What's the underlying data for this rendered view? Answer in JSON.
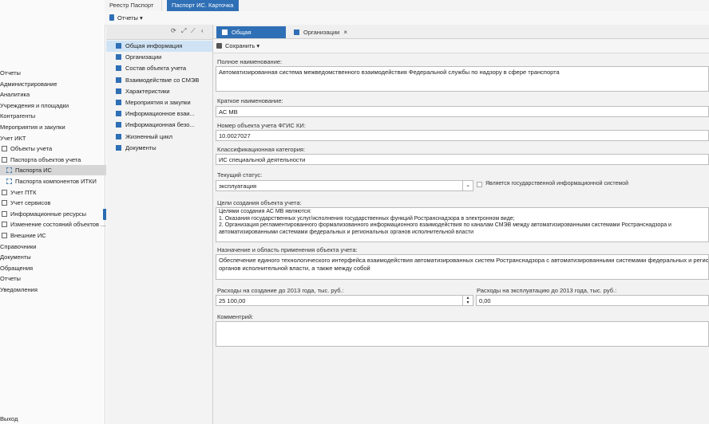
{
  "nav": {
    "items": [
      {
        "label": "Отчеты",
        "indent": 0,
        "icon": "none"
      },
      {
        "label": "Администрирование",
        "indent": 0,
        "icon": "none"
      },
      {
        "label": "Аналитика",
        "indent": 0,
        "icon": "none"
      },
      {
        "label": "Учреждения и площадки",
        "indent": 0,
        "icon": "none"
      },
      {
        "label": "Контрагенты",
        "indent": 0,
        "icon": "none"
      },
      {
        "label": "Мероприятия и закупки",
        "indent": 0,
        "icon": "none"
      },
      {
        "label": "Учет ИКТ",
        "indent": 0,
        "icon": "none"
      },
      {
        "label": "Объекты учета",
        "indent": 1,
        "icon": "square"
      },
      {
        "label": "Паспорта объектов учета",
        "indent": 1,
        "icon": "square"
      },
      {
        "label": "Паспорта ИС",
        "indent": 2,
        "icon": "dashed",
        "selected": true
      },
      {
        "label": "Паспорта компонентов ИТКИ",
        "indent": 2,
        "icon": "dashed"
      },
      {
        "label": "Учет ПТК",
        "indent": 1,
        "icon": "square"
      },
      {
        "label": "Учет сервисов",
        "indent": 1,
        "icon": "square"
      },
      {
        "label": "Информационные ресурсы",
        "indent": 1,
        "icon": "square"
      },
      {
        "label": "Изменение состояний объектов ...",
        "indent": 1,
        "icon": "square"
      },
      {
        "label": "Внешние ИС",
        "indent": 1,
        "icon": "square"
      },
      {
        "label": "Справочники",
        "indent": 0,
        "icon": "none"
      },
      {
        "label": "Документы",
        "indent": 0,
        "icon": "none"
      },
      {
        "label": "Обращения",
        "indent": 0,
        "icon": "none"
      },
      {
        "label": "Отчеты",
        "indent": 0,
        "icon": "none"
      },
      {
        "label": "Уведомления",
        "indent": 0,
        "icon": "none"
      }
    ],
    "exit_label": "Выход"
  },
  "top_tabs": [
    {
      "label": "Реестр Паспорт ИС",
      "active": false
    },
    {
      "label": "Паспорт ИС. Карточка",
      "active": true
    }
  ],
  "reports_label": "Отчеты",
  "sections": [
    {
      "label": "Общая информация",
      "selected": true
    },
    {
      "label": "Организации"
    },
    {
      "label": "Состав объекта учета"
    },
    {
      "label": "Взаимодействие со СМЭВ"
    },
    {
      "label": "Характеристики"
    },
    {
      "label": "Мероприятия и закупки"
    },
    {
      "label": "Информационное взаи..."
    },
    {
      "label": "Информационная безо..."
    },
    {
      "label": "Жизненный цикл"
    },
    {
      "label": "Документы"
    }
  ],
  "sub_tabs": [
    {
      "label": "Общая информация",
      "active": true
    },
    {
      "label": "Организации",
      "active": false
    }
  ],
  "save_label": "Сохранить",
  "form": {
    "full_name_label": "Полное наименование:",
    "full_name": "Автоматизированная система межведомственного взаимодействия Федеральной службы по надзору в сфере транспорта",
    "short_name_label": "Краткое наименование:",
    "short_name": "АС МВ",
    "fgis_label": "Номер объекта учета ФГИС КИ:",
    "fgis": "10.0027027",
    "class_label": "Классификационная категория:",
    "class": "ИС специальной деятельности",
    "status_label": "Текущий статус:",
    "status": "эксплуатация",
    "gis_checkbox_label": "Является государственной информационной системой",
    "goals_label": "Цели создания объекта учета:",
    "goals_lines": [
      "Целями создания АС МВ являются:",
      "1. Оказания государственных услуг/исполнения государственных функций Ространснадзора в электронном виде;",
      "2. Организация регламентированного формализованного информационного взаимодействия по каналам СМЭВ между автоматизированными системами Ространснадзора и",
      "автоматизированными системами федеральных и региональных органов исполнительной власти"
    ],
    "purpose_label": "Назначение и область применения объекта учета:",
    "purpose_lines": [
      "Обеспечение единого технологического интерфейса взаимодействия автоматизированных систем Ространснадзора с автоматизированными системами федеральных и региональ",
      "органов исполнительной власти, а также между собой"
    ],
    "cost_create_label": "Расходы на создание до 2013 года, тыс. руб.:",
    "cost_create": "25 100,00",
    "cost_operate_label": "Расходы на эксплуатацию до 2013 года, тыс. руб.:",
    "cost_operate": "0,00",
    "comment_label": "Комментрий:",
    "comment": ""
  },
  "colors": {
    "accent": "#2f6fb5",
    "selected_row": "#cfe3f5",
    "nav_selected": "#d6d6d6"
  }
}
